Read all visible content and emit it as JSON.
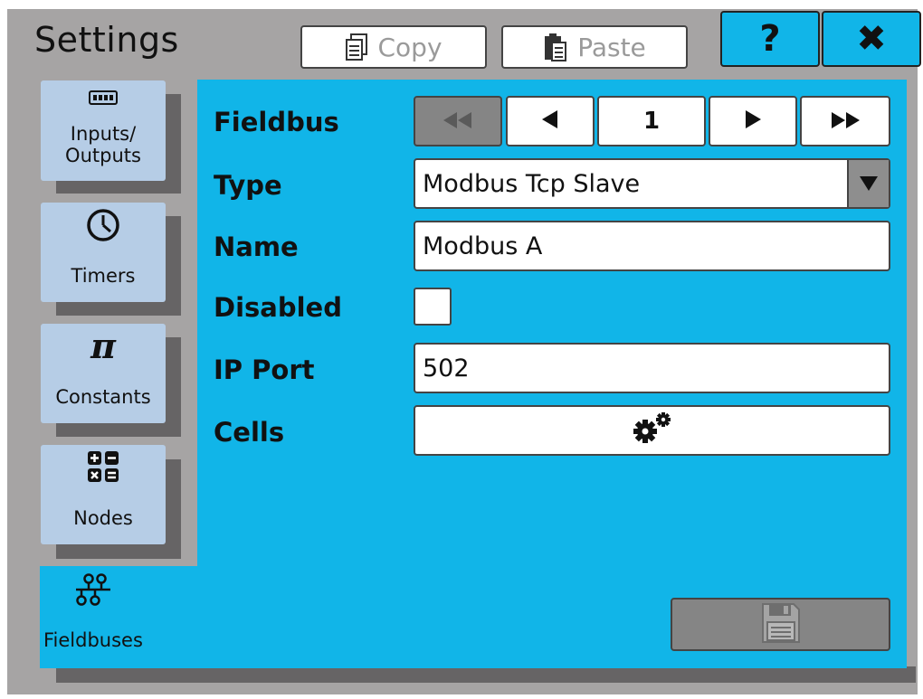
{
  "header": {
    "title": "Settings",
    "copy_label": "Copy",
    "paste_label": "Paste",
    "help_label": "?",
    "close_label": "✖"
  },
  "sidebar": {
    "items": [
      {
        "label_line1": "Inputs/",
        "label_line2": "Outputs",
        "icon": "io-module-icon"
      },
      {
        "label": "Timers",
        "icon": "clock-icon"
      },
      {
        "label": "Constants",
        "icon": "pi-icon",
        "glyph": "π"
      },
      {
        "label": "Nodes",
        "icon": "calculator-icon"
      },
      {
        "label": "Fieldbuses",
        "icon": "network-icon",
        "selected": true
      }
    ]
  },
  "form": {
    "fieldbus_label": "Fieldbus",
    "nav": {
      "first": "◀◀",
      "prev": "◀",
      "page": "1",
      "next": "▶",
      "last": "▶▶"
    },
    "type_label": "Type",
    "type_value": "Modbus Tcp Slave",
    "name_label": "Name",
    "name_value": "Modbus A",
    "disabled_label": "Disabled",
    "disabled_checked": false,
    "ip_port_label": "IP Port",
    "ip_port_value": "502",
    "cells_label": "Cells",
    "cells_icon": "gears-icon",
    "save_icon": "floppy-disk-icon"
  },
  "colors": {
    "accent": "#11b5e8",
    "tab_bg": "#b6cde6",
    "frame": "#a6a4a4",
    "shadow": "#666465",
    "disabled": "#858585"
  }
}
